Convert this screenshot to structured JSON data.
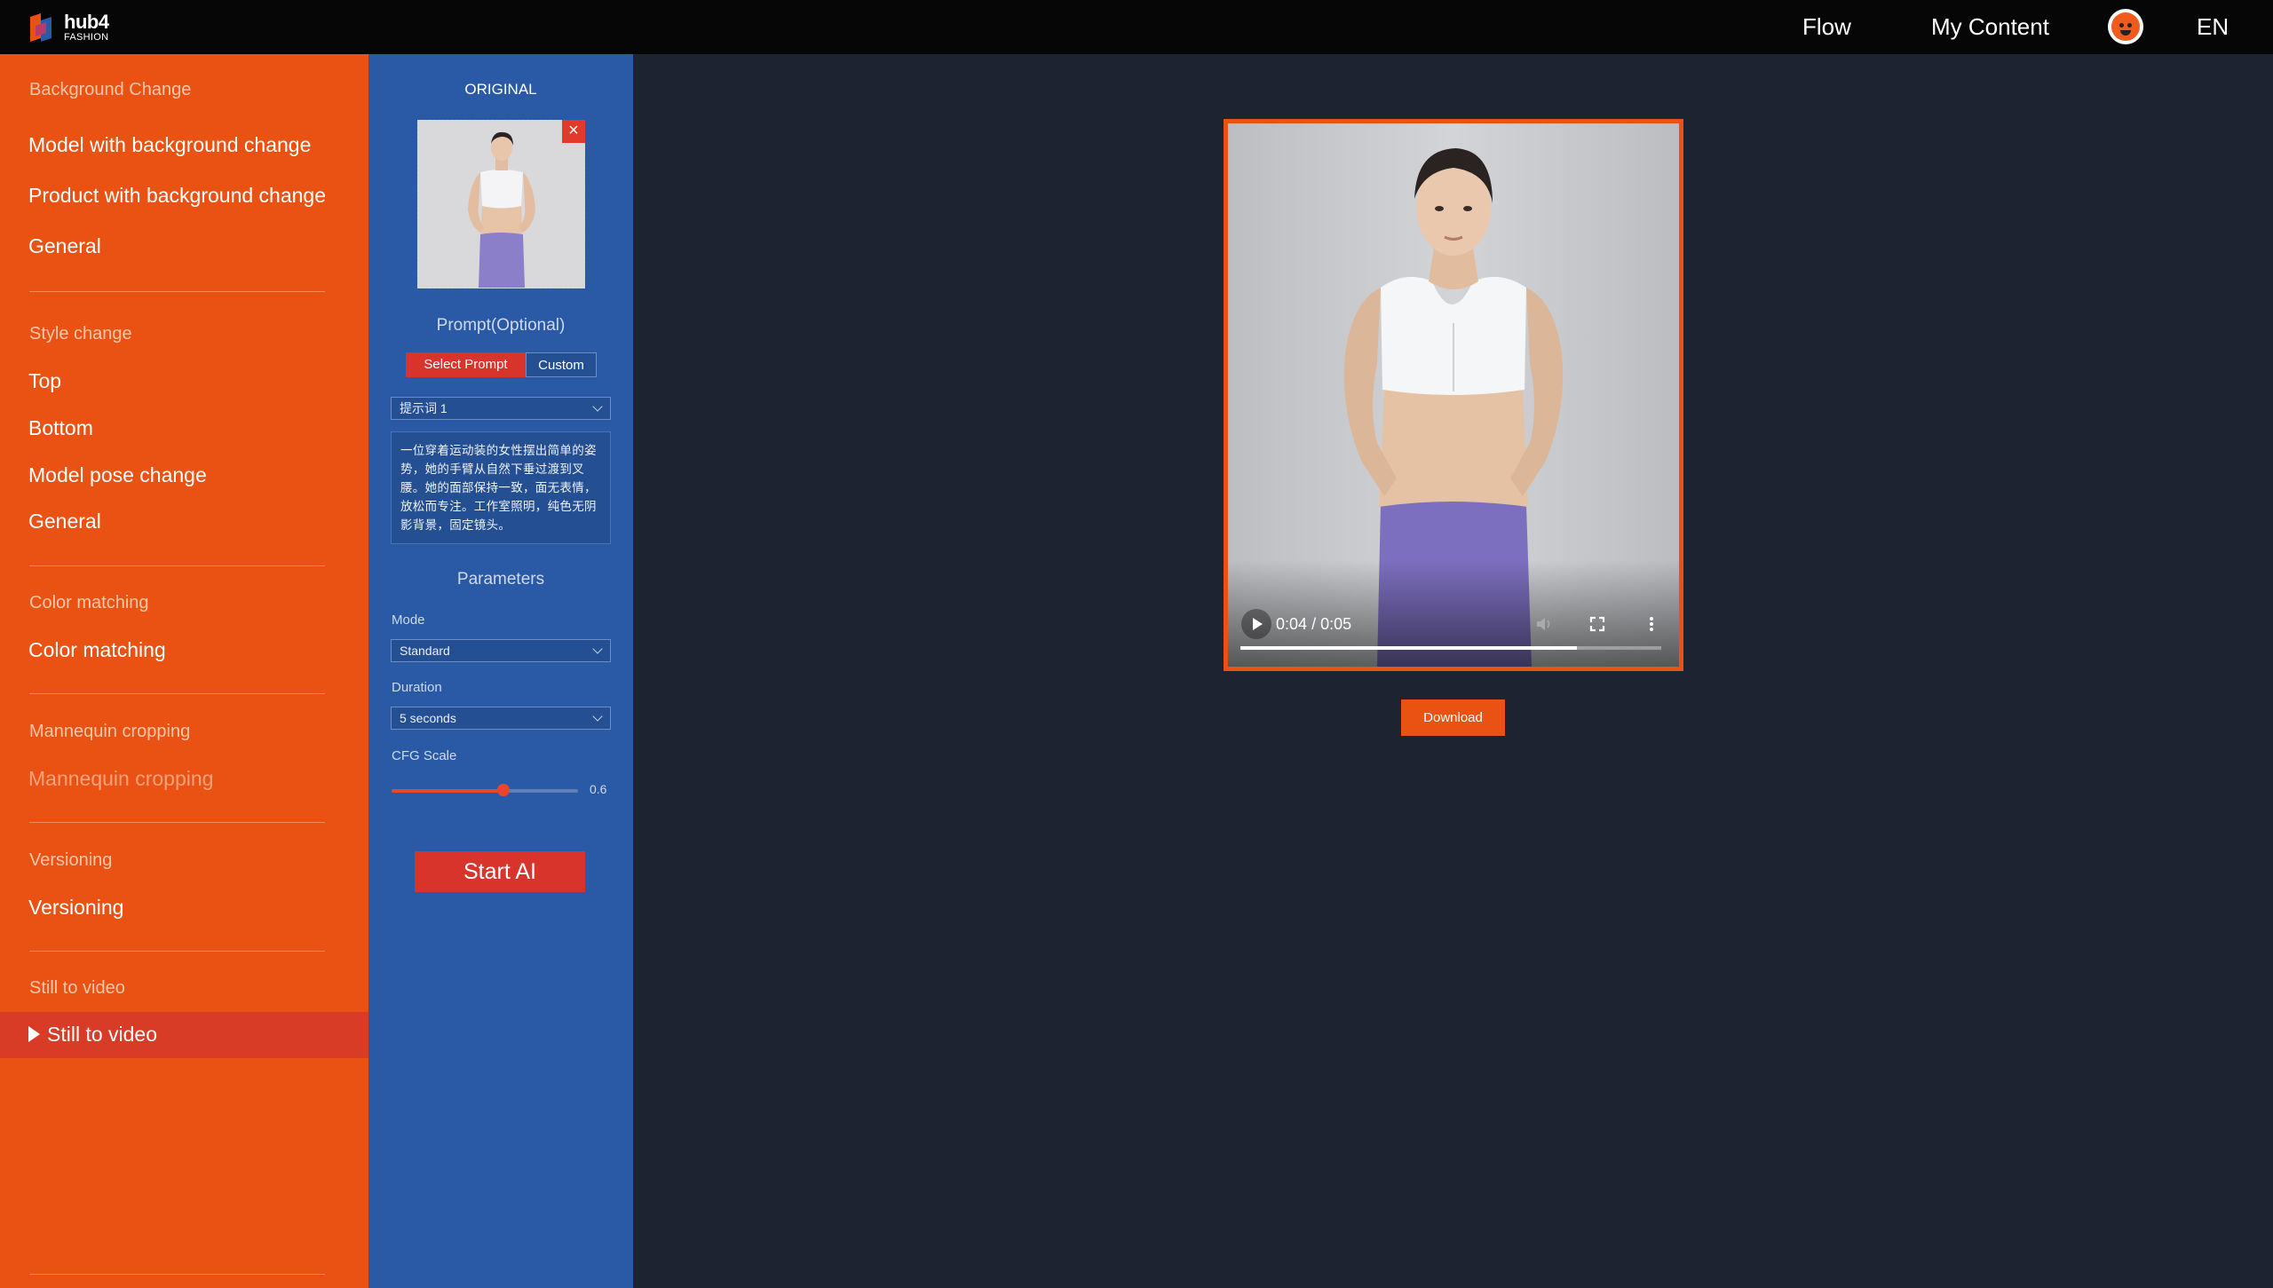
{
  "header": {
    "logo_line1": "hub4",
    "logo_line2": "FASHION",
    "nav": [
      "Flow",
      "My Content"
    ],
    "language": "EN"
  },
  "sidebar": {
    "sections": [
      {
        "title": "Background Change",
        "items": [
          "Model with background change",
          "Product with background change",
          "General"
        ]
      },
      {
        "title": "Style change",
        "items": [
          "Top",
          "Bottom",
          "Model pose change",
          "General"
        ]
      },
      {
        "title": "Color matching",
        "items": [
          "Color matching"
        ]
      },
      {
        "title": "Mannequin cropping",
        "items": [
          "Mannequin cropping"
        ]
      },
      {
        "title": "Versioning",
        "items": [
          "Versioning"
        ]
      },
      {
        "title": "Still to video",
        "items": [
          "Still to video"
        ]
      }
    ],
    "active_item": "Still to video"
  },
  "panel": {
    "original_label": "ORIGINAL",
    "close_glyph": "×",
    "prompt_label": "Prompt(Optional)",
    "prompt_tabs": [
      "Select Prompt",
      "Custom"
    ],
    "prompt_select_value": "提示词 1",
    "prompt_text": "一位穿着运动装的女性摆出简单的姿势，她的手臂从自然下垂过渡到叉腰。她的面部保持一致，面无表情，放松而专注。工作室照明，纯色无阴影背景，固定镜头。",
    "parameters_label": "Parameters",
    "mode_label": "Mode",
    "mode_value": "Standard",
    "duration_label": "Duration",
    "duration_value": "5 seconds",
    "cfg_label": "CFG Scale",
    "cfg_value": "0.6",
    "cfg_fraction": 0.6,
    "start_button": "Start AI"
  },
  "player": {
    "current_time": "0:04",
    "separator": "/",
    "total_time": "0:05",
    "progress_fraction": 0.8,
    "download_label": "Download"
  },
  "colors": {
    "brand_orange": "#ea5214",
    "active_red": "#d93c26",
    "panel_blue": "#2a5aa5",
    "main_bg": "#1d2330"
  }
}
